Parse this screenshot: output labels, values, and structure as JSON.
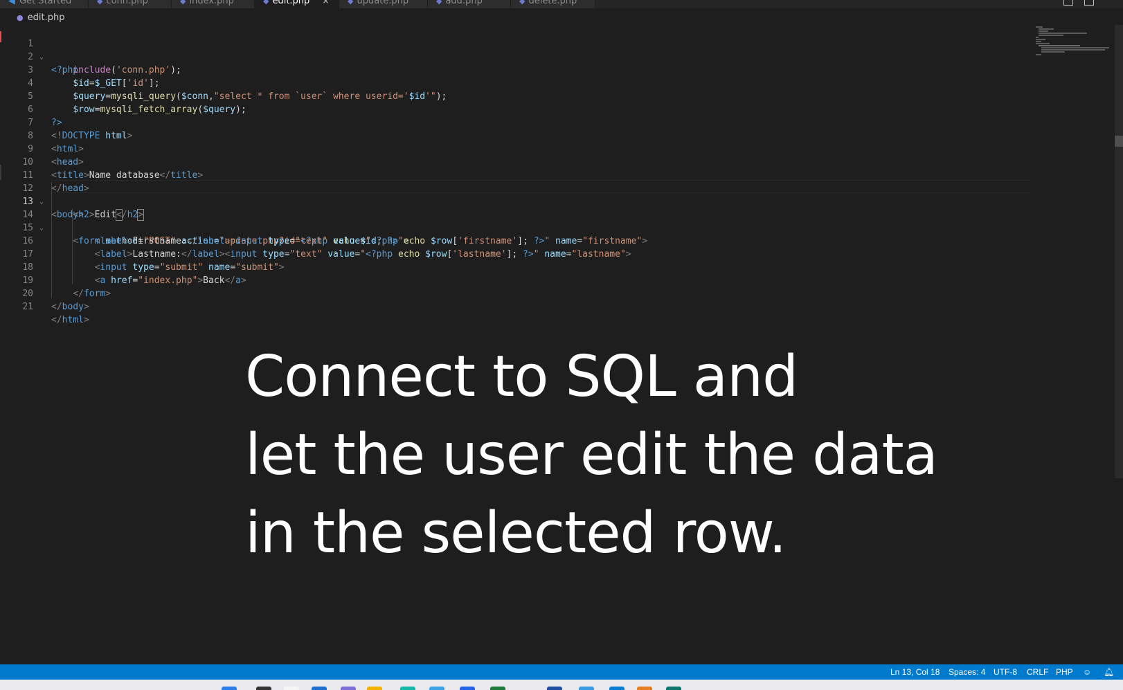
{
  "tabs": [
    {
      "label": "Get Started",
      "icon": "vscode-icon"
    },
    {
      "label": "conn.php",
      "icon": "php-icon"
    },
    {
      "label": "index.php",
      "icon": "php-icon"
    },
    {
      "label": "edit.php",
      "icon": "php-icon",
      "active": true,
      "close": "×"
    },
    {
      "label": "update.php",
      "icon": "php-icon"
    },
    {
      "label": "add.php",
      "icon": "php-icon"
    },
    {
      "label": "delete.php",
      "icon": "php-icon"
    }
  ],
  "breadcrumb": {
    "file": "edit.php",
    "icon": "php-elephant-icon"
  },
  "editor": {
    "current_line": 13,
    "line_numbers": [
      "1",
      "2",
      "3",
      "4",
      "5",
      "6",
      "7",
      "8",
      "9",
      "10",
      "11",
      "12",
      "13",
      "14",
      "15",
      "16",
      "17",
      "18",
      "19",
      "20",
      "21"
    ]
  },
  "caption": {
    "line1": "Connect to SQL and",
    "line2": "let the user edit the data",
    "line3": "in the selected row."
  },
  "statusbar": {
    "position": "Ln 13, Col 18",
    "spaces": "Spaces: 4",
    "encoding": "UTF-8",
    "eol": "CRLF",
    "language": "PHP"
  }
}
